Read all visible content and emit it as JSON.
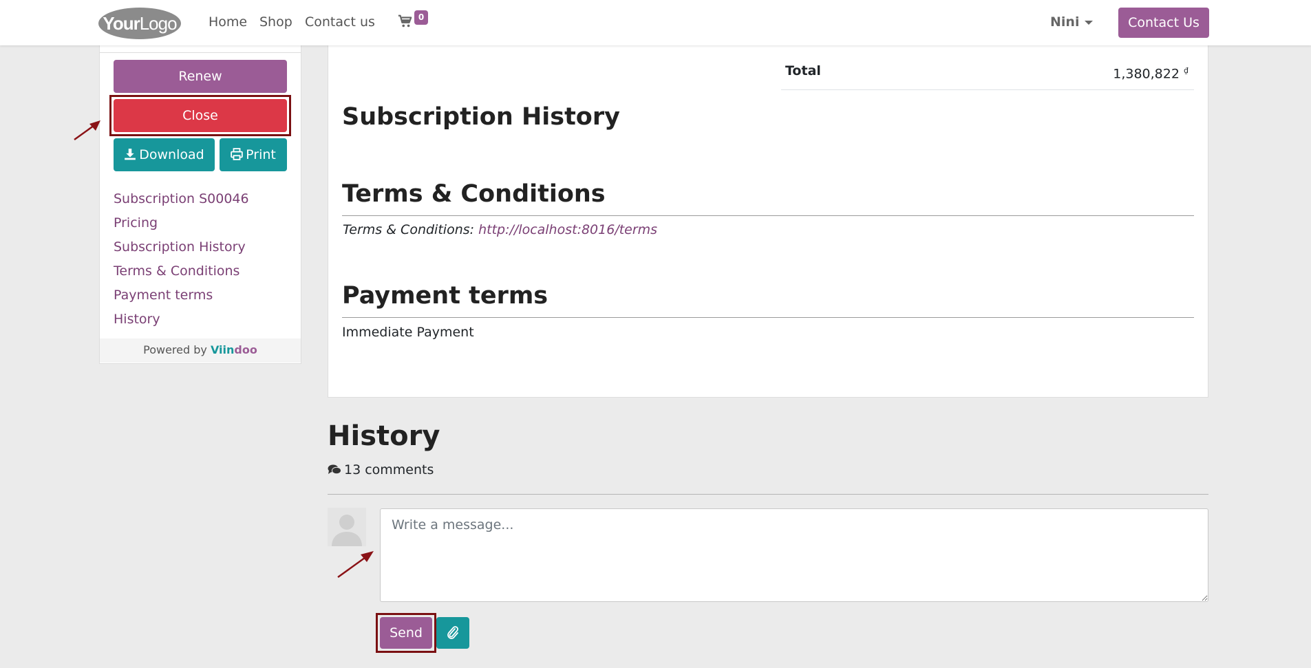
{
  "navbar": {
    "logo": {
      "bold": "Your",
      "light": "Logo"
    },
    "links": [
      "Home",
      "Shop",
      "Contact us"
    ],
    "cart_count": "0",
    "user_name": "Nini",
    "contact_button": "Contact Us"
  },
  "sidebar": {
    "renew_label": "Renew",
    "close_label": "Close",
    "download_label": "Download",
    "print_label": "Print",
    "links": [
      "Subscription S00046",
      "Pricing",
      "Subscription History",
      "Terms & Conditions",
      "Payment terms",
      "History"
    ],
    "powered_by": "Powered by",
    "powered_brand_a": "Viin",
    "powered_brand_b": "doo"
  },
  "summary": {
    "total_label": "Total",
    "total_value": "1,380,822",
    "currency_symbol": "₫"
  },
  "sections": {
    "subscription_history_title": "Subscription History",
    "terms_title": "Terms & Conditions",
    "terms_prefix": "Terms & Conditions:",
    "terms_url": "http://localhost:8016/terms",
    "payment_title": "Payment terms",
    "payment_value": "Immediate Payment"
  },
  "history": {
    "title": "History",
    "comments": "13 comments",
    "message_placeholder": "Write a message...",
    "send_label": "Send"
  },
  "colors": {
    "primary": "#9b5c96",
    "danger": "#dc3847",
    "teal": "#17979b",
    "highlight": "#7a1012",
    "background": "#ebebeb"
  },
  "icons": [
    "cart-icon",
    "caret-down-icon",
    "download-icon",
    "print-icon",
    "comments-icon",
    "avatar-icon",
    "paperclip-icon",
    "annotation-arrow-icon"
  ]
}
